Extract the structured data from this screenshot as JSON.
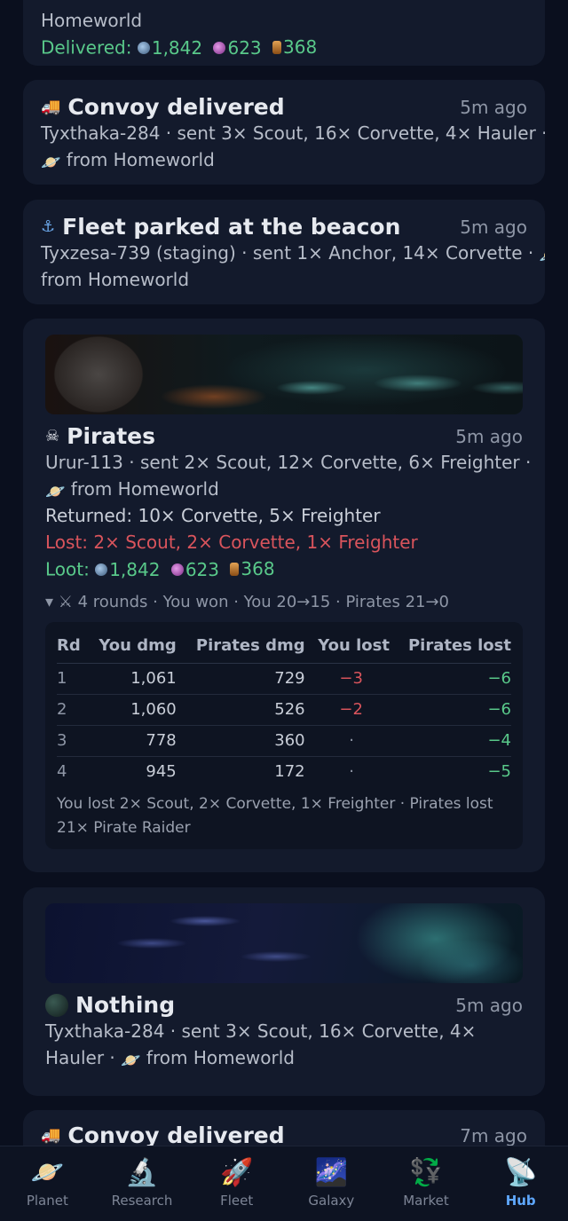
{
  "card0": {
    "line1": "Homeworld",
    "delivered_label": "Delivered:",
    "metal": "1,842",
    "crystal": "623",
    "fuel": "368"
  },
  "card1": {
    "icon": "truck-icon",
    "title": "Convoy delivered",
    "ago": "5m ago",
    "line1": "Tyxthaka-284 · sent 3× Scout, 16× Corvette, 4× Hauler ·",
    "line2": "from Homeworld"
  },
  "card2": {
    "icon": "anchor-icon",
    "title": "Fleet parked at the beacon",
    "ago": "5m ago",
    "line1": "Tyxzesa-739 (staging) · sent 1× Anchor, 14× Corvette ·",
    "line2": "from Homeworld"
  },
  "card3": {
    "icon": "skull-crossbones-icon",
    "title": "Pirates",
    "ago": "5m ago",
    "line1": "Urur-113 · sent 2× Scout, 12× Corvette, 6× Freighter ·",
    "line2": "from Homeworld",
    "returned": "Returned: 10× Corvette, 5× Freighter",
    "lost": "Lost: 2× Scout, 2× Corvette, 1× Freighter",
    "loot_label": "Loot:",
    "metal": "1,842",
    "crystal": "623",
    "fuel": "368",
    "rounds_summary": "▾ ⚔ 4 rounds · You won · You 20→15 · Pirates 21→0",
    "table": {
      "headers": [
        "Rd",
        "You dmg",
        "Pirates dmg",
        "You lost",
        "Pirates lost"
      ],
      "rows": [
        [
          "1",
          "1,061",
          "729",
          "−3",
          "−6"
        ],
        [
          "2",
          "1,060",
          "526",
          "−2",
          "−6"
        ],
        [
          "3",
          "778",
          "360",
          "·",
          "−4"
        ],
        [
          "4",
          "945",
          "172",
          "·",
          "−5"
        ]
      ]
    },
    "battle_foot_1": "You lost 2× Scout, 2× Corvette, 1× Freighter · Pirates lost",
    "battle_foot_2": "21× Pirate Raider"
  },
  "card4": {
    "icon": "dark-planet-icon",
    "title": "Nothing",
    "ago": "5m ago",
    "line1": "Tyxthaka-284 · sent 3× Scout, 16× Corvette, 4×",
    "line2a": "Hauler ·",
    "line2b": "from Homeworld"
  },
  "card5": {
    "icon": "truck-icon",
    "title": "Convoy delivered",
    "ago": "7m ago"
  },
  "nav": [
    {
      "label": "Planet",
      "icon": "planet-icon"
    },
    {
      "label": "Research",
      "icon": "microscope-icon"
    },
    {
      "label": "Fleet",
      "icon": "rocket-icon"
    },
    {
      "label": "Galaxy",
      "icon": "galaxy-icon"
    },
    {
      "label": "Market",
      "icon": "currency-exchange-icon"
    },
    {
      "label": "Hub",
      "icon": "satellite-dish-icon",
      "active": true
    }
  ]
}
